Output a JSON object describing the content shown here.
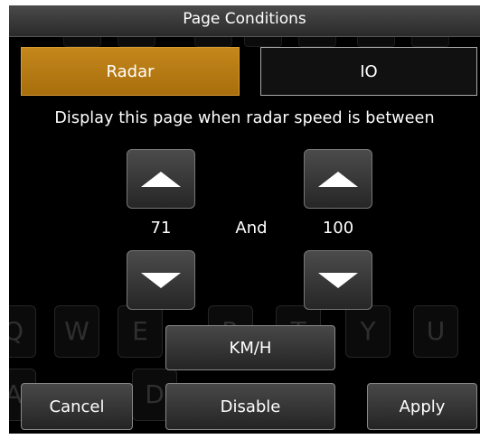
{
  "dialog": {
    "title": "Page Conditions"
  },
  "tabs": {
    "radar": "Radar",
    "io": "IO"
  },
  "prompt": "Display this page when radar speed is between",
  "range": {
    "min": "71",
    "conjunction": "And",
    "max": "100"
  },
  "unit_button": "KM/H",
  "footer": {
    "cancel": "Cancel",
    "disable": "Disable",
    "apply": "Apply"
  },
  "background_keys": [
    "Q",
    "W",
    "E",
    "R",
    "T",
    "Y",
    "U",
    "A",
    "D"
  ],
  "colors": {
    "accent": "#b57a16",
    "background": "#000000",
    "button": "#363636"
  }
}
